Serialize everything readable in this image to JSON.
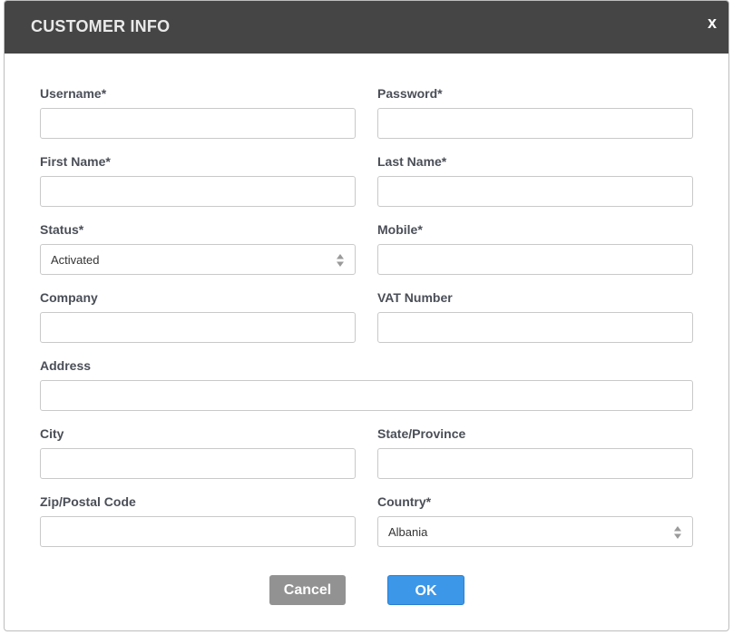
{
  "dialog": {
    "title": "CUSTOMER INFO",
    "close_label": "x"
  },
  "fields": {
    "username": {
      "label": "Username*",
      "value": ""
    },
    "password": {
      "label": "Password*",
      "value": ""
    },
    "first_name": {
      "label": "First Name*",
      "value": ""
    },
    "last_name": {
      "label": "Last Name*",
      "value": ""
    },
    "status": {
      "label": "Status*",
      "value": "Activated"
    },
    "mobile": {
      "label": "Mobile*",
      "value": ""
    },
    "company": {
      "label": "Company",
      "value": ""
    },
    "vat_number": {
      "label": "VAT Number",
      "value": ""
    },
    "address": {
      "label": "Address",
      "value": ""
    },
    "city": {
      "label": "City",
      "value": ""
    },
    "state_province": {
      "label": "State/Province",
      "value": ""
    },
    "zip_postal_code": {
      "label": "Zip/Postal Code",
      "value": ""
    },
    "country": {
      "label": "Country*",
      "value": "Albania"
    }
  },
  "buttons": {
    "cancel_label": "Cancel",
    "ok_label": "OK"
  },
  "colors": {
    "header_bg": "#454545",
    "ok_button": "#3d97e8",
    "cancel_button": "#929292"
  },
  "icons": {
    "close": "close-icon",
    "select_arrows": "updown-arrows-icon"
  }
}
